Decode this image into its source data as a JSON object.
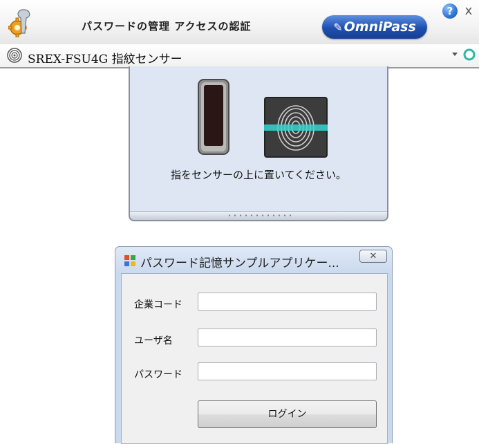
{
  "header": {
    "title": "パスワードの管理 アクセスの認証",
    "logo_text": "OmniPass",
    "help_symbol": "?",
    "close_symbol": "x",
    "icons": {
      "settings": "wrench-gear-icon",
      "help": "help-icon",
      "close": "close-icon"
    }
  },
  "sensor": {
    "name": "SREX-FSU4G 指紋センサー",
    "icon": "fingerprint-sensor-icon",
    "dropdown_icon": "chevron-down-icon",
    "refresh_icon": "refresh-icon"
  },
  "fingerprint_panel": {
    "instruction": "指をセンサーの上に置いてください。",
    "icons": {
      "device": "sensor-device-icon",
      "scan": "fingerprint-scan-icon"
    }
  },
  "dialog": {
    "title": "パスワード記憶サンプルアプリケー...",
    "close_symbol": "✕",
    "icon": "application-icon",
    "fields": {
      "company_code": {
        "label": "企業コード",
        "value": ""
      },
      "username": {
        "label": "ユーザ名",
        "value": ""
      },
      "password": {
        "label": "パスワード",
        "value": ""
      }
    },
    "login_label": "ログイン"
  },
  "colors": {
    "logo_blue": "#1e4fb0",
    "panel_background": "#dde6f2",
    "scan_line": "#35d6d0",
    "dialog_background": "#f0f0f0"
  }
}
